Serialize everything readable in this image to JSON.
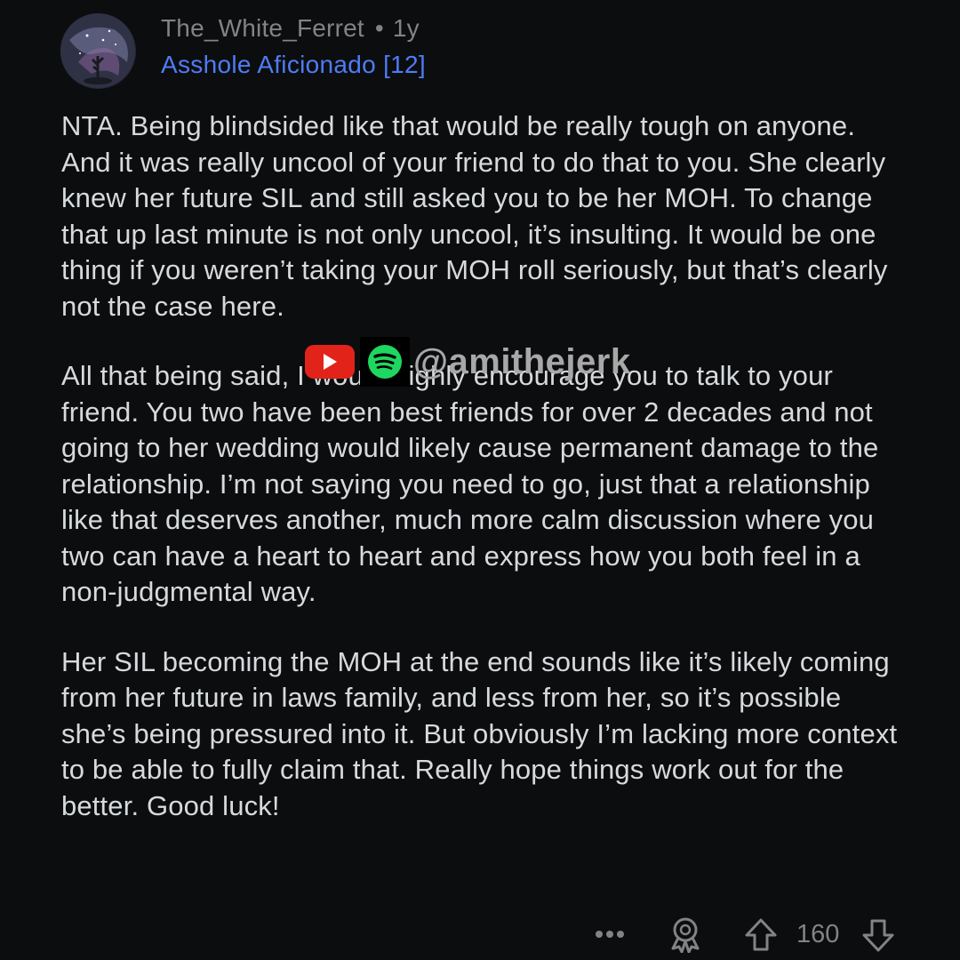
{
  "comment": {
    "username": "The_White_Ferret",
    "separator": "•",
    "age": "1y",
    "flair": "Asshole Aficionado [12]",
    "paragraphs": [
      "NTA. Being blindsided like that would be really tough on anyone. And it was really uncool of your friend to do that to you. She clearly knew her future SIL and still asked you to be her MOH. To change that up last minute is not only uncool, it’s insulting. It would be one thing if you weren’t taking your MOH roll seriously, but that’s clearly not the case here.",
      "All that being said, I would highly encourage you to talk to your friend. You two have been best friends for over 2 decades and not going to her wedding would likely cause permanent damage to the relationship. I’m not saying you need to go, just that a relationship like that deserves another, much more calm discussion where you two can have a heart to heart and express how you both feel in a non-judgmental way.",
      "Her SIL becoming the MOH at the end sounds like it’s likely coming from her future in laws family, and less from her, so it’s possible she’s being pressured into it. But obviously I’m lacking more context to be able to fully claim that. Really hope things work out for the better. Good luck!"
    ],
    "vote_count": "160"
  },
  "watermark": {
    "handle": "@amithejerk"
  },
  "icons": {
    "avatar": "avatar-image",
    "youtube": "youtube-icon",
    "spotify": "spotify-icon",
    "more": "more-options-icon",
    "award": "award-icon",
    "upvote": "upvote-arrow-icon",
    "downvote": "downvote-arrow-icon"
  },
  "colors": {
    "background": "#0c0d0f",
    "text": "#d7dadc",
    "meta": "#818384",
    "flair": "#4f7cf5",
    "youtube_red": "#e2231a",
    "spotify_green": "#1ed760"
  }
}
